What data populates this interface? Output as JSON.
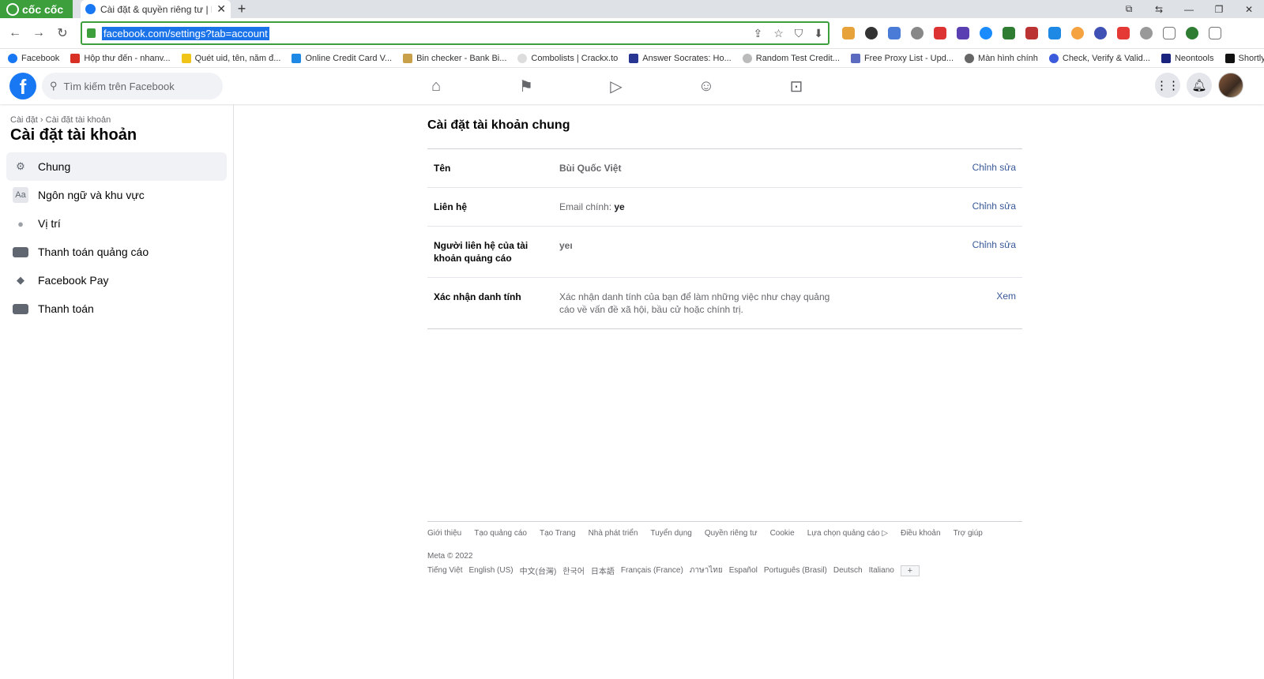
{
  "browser": {
    "brand": "cốc cốc",
    "tab_title": "Cài đặt & quyền riêng tư | Fa",
    "url": "facebook.com/settings?tab=account",
    "bookmarks": [
      "Facebook",
      "Hộp thư đến - nhanv...",
      "Quét uid, tên, năm đ...",
      "Online Credit Card V...",
      "Bin checker - Bank Bi...",
      "Combolists | Crackx.to",
      "Answer Socrates: Ho...",
      "Random Test Credit...",
      "Free Proxy List - Upd...",
      "Màn hình chính",
      "Check, Verify & Valid...",
      "Neontools",
      "ShortlyAI | Your AI W..."
    ]
  },
  "facebook": {
    "search_placeholder": "Tìm kiếm trên Facebook",
    "brand_color": "#1877f2"
  },
  "sidebar": {
    "breadcrumb": "Cài đặt › Cài đặt tài khoản",
    "title": "Cài đặt tài khoản",
    "items": [
      {
        "label": "Chung",
        "icon": "gear-icon"
      },
      {
        "label": "Ngôn ngữ và khu vực",
        "icon": "language-icon"
      },
      {
        "label": "Vị trí",
        "icon": "location-pin-icon"
      },
      {
        "label": "Thanh toán quảng cáo",
        "icon": "card-icon"
      },
      {
        "label": "Facebook Pay",
        "icon": "tag-icon"
      },
      {
        "label": "Thanh toán",
        "icon": "card-icon"
      }
    ]
  },
  "main": {
    "title": "Cài đặt tài khoản chung",
    "rows": [
      {
        "label": "Tên",
        "value": "Bùi Quốc Việt",
        "action": "Chỉnh sửa"
      },
      {
        "label": "Liên hệ",
        "value_prefix": "Email chính: ",
        "value_bold": "ye",
        "action": "Chỉnh sửa"
      },
      {
        "label": "Người liên hệ của tài khoản quảng cáo",
        "value": "yeı",
        "action": "Chỉnh sửa"
      },
      {
        "label": "Xác nhận danh tính",
        "value": "Xác nhận danh tính của bạn để làm những việc như chạy quảng cáo về vấn đề xã hội, bầu cử hoặc chính trị.",
        "action": "Xem"
      }
    ]
  },
  "footer": {
    "links": [
      "Giới thiệu",
      "Tạo quảng cáo",
      "Tạo Trang",
      "Nhà phát triển",
      "Tuyển dụng",
      "Quyền riêng tư",
      "Cookie",
      "Lựa chọn quảng cáo ▷",
      "Điều khoản",
      "Trợ giúp"
    ],
    "copyright": "Meta © 2022",
    "languages": [
      "Tiếng Việt",
      "English (US)",
      "中文(台灣)",
      "한국어",
      "日本語",
      "Français (France)",
      "ภาษาไทย",
      "Español",
      "Português (Brasil)",
      "Deutsch",
      "Italiano"
    ],
    "more": "+"
  }
}
